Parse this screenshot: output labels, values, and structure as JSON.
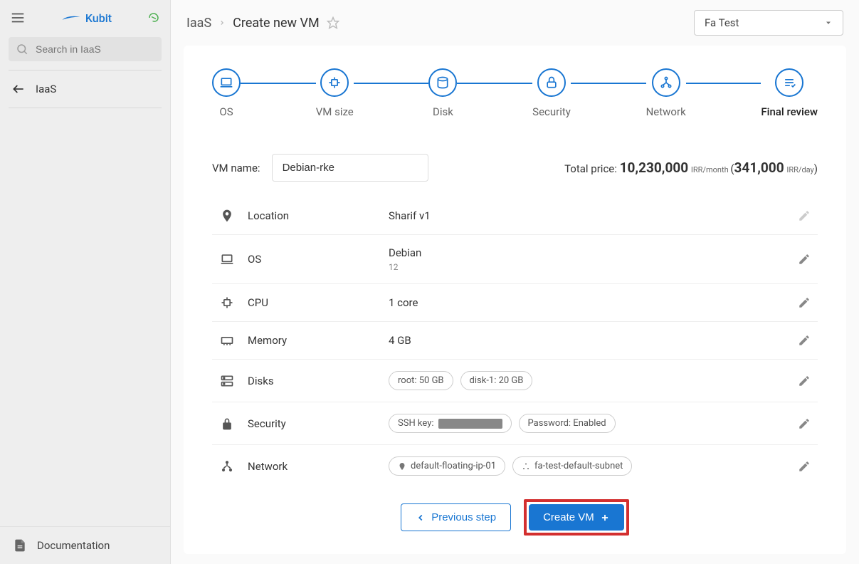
{
  "brand": "Kubit",
  "search": {
    "placeholder": "Search in IaaS"
  },
  "nav": {
    "back_label": "IaaS"
  },
  "doc_label": "Documentation",
  "breadcrumb": {
    "root": "IaaS",
    "current": "Create new VM"
  },
  "project_selected": "Fa Test",
  "stepper": [
    {
      "label": "OS"
    },
    {
      "label": "VM size"
    },
    {
      "label": "Disk"
    },
    {
      "label": "Security"
    },
    {
      "label": "Network"
    },
    {
      "label": "Final review"
    }
  ],
  "vm_name": {
    "label": "VM name:",
    "value": "Debian-rke"
  },
  "price": {
    "prefix": "Total price: ",
    "monthly": "10,230,000",
    "monthly_unit": "IRR/month",
    "daily": "341,000",
    "daily_unit": "IRR/day"
  },
  "review": {
    "location": {
      "label": "Location",
      "value": "Sharif v1"
    },
    "os": {
      "label": "OS",
      "value": "Debian",
      "sub": "12"
    },
    "cpu": {
      "label": "CPU",
      "value": "1 core"
    },
    "memory": {
      "label": "Memory",
      "value": "4 GB"
    },
    "disks": {
      "label": "Disks",
      "chips": [
        "root: 50 GB",
        "disk-1: 20 GB"
      ]
    },
    "security": {
      "label": "Security",
      "ssh_prefix": "SSH key:",
      "password_chip": "Password: Enabled"
    },
    "network": {
      "label": "Network",
      "chips": [
        "default-floating-ip-01",
        "fa-test-default-subnet"
      ]
    }
  },
  "buttons": {
    "prev": "Previous step",
    "create": "Create VM"
  }
}
